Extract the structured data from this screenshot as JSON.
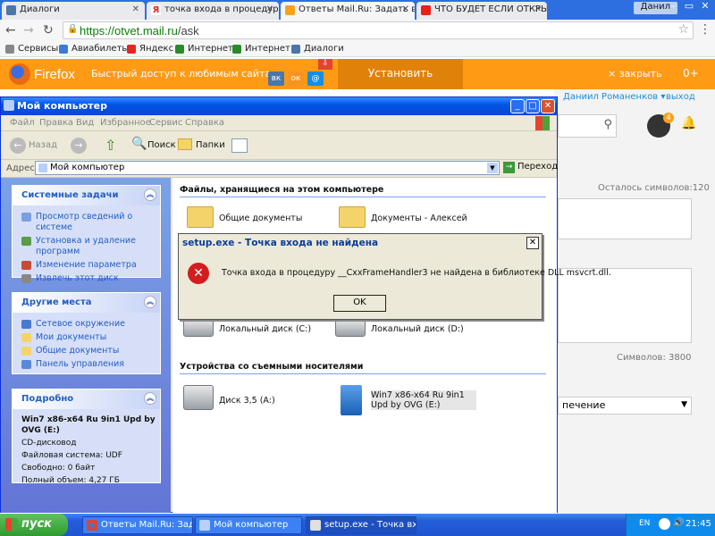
{
  "browser": {
    "tabs": [
      {
        "title": "Диалоги"
      },
      {
        "title": "точка входа в процедуру"
      },
      {
        "title": "Ответы Mail.Ru: Задать во"
      },
      {
        "title": "ЧТО БУДЕТ ЕСЛИ ОТКРЫ"
      }
    ],
    "user_chip": "Данил",
    "url_prefix": "https://otvet.mail.ru",
    "url_path": "/ask",
    "bookmarks": [
      "Сервисы",
      "Авиабилеты",
      "Яндекс",
      "Интернет",
      "Интернет",
      "Диалоги"
    ]
  },
  "firefox_bar": {
    "name": "Firefox",
    "tagline": "Быстрый доступ к любимым сайтам",
    "install": "Установить",
    "close": "× закрыть",
    "plus": "0+"
  },
  "mail_page": {
    "user": "Даниил Романенков ▾",
    "exit": "выход",
    "remaining": "Осталось символов:120",
    "symbols": "Символов: 3800",
    "select_value": "печение"
  },
  "explorer": {
    "title": "Мой компьютер",
    "menu": [
      "Файл",
      "Правка",
      "Вид",
      "Избранное",
      "Сервис",
      "Справка"
    ],
    "toolbar": {
      "back": "Назад",
      "search": "Поиск",
      "folders": "Папки"
    },
    "address_label": "Адрес:",
    "address_value": "Мой компьютер",
    "go": "Переход",
    "panels": {
      "system": {
        "title": "Системные задачи",
        "links": [
          "Просмотр сведений о системе",
          "Установка и удаление программ",
          "Изменение параметра",
          "Извлечь этот диск"
        ]
      },
      "places": {
        "title": "Другие места",
        "links": [
          "Сетевое окружение",
          "Мои документы",
          "Общие документы",
          "Панель управления"
        ]
      },
      "details": {
        "title": "Подробно",
        "name": "Win7 x86-x64 Ru 9in1 Upd by OVG (E:)",
        "type": "CD-дисковод",
        "fs": "Файловая система: UDF",
        "free": "Свободно: 0 байт",
        "total": "Полный объем: 4,27 ГБ"
      }
    },
    "sections": {
      "files_header": "Файлы, хранящиеся на этом компьютере",
      "shared_docs": "Общие документы",
      "alexey_docs": "Документы - Алексей",
      "disk_c": "Локальный диск (C:)",
      "disk_d": "Локальный диск (D:)",
      "removable_header": "Устройства со съемными носителями",
      "floppy": "Диск 3,5 (A:)",
      "dvd": "Win7 x86-x64 Ru 9in1 Upd by OVG (E:)"
    }
  },
  "error_dialog": {
    "title": "setup.exe - Точка входа не найдена",
    "message": "Точка входа в процедуру __CxxFrameHandler3 не найдена в библиотеке DLL msvcrt.dll.",
    "ok": "OK"
  },
  "taskbar": {
    "start": "пуск",
    "tasks": [
      "Ответы Mail.Ru: Зад...",
      "Мой компьютер",
      "setup.exe - Точка вх..."
    ],
    "lang": "EN",
    "clock": "21:45"
  },
  "colors": {
    "xp_blue": "#0054e3",
    "ff_orange": "#fe9a14",
    "chrome_blue": "#2d6fe0"
  }
}
